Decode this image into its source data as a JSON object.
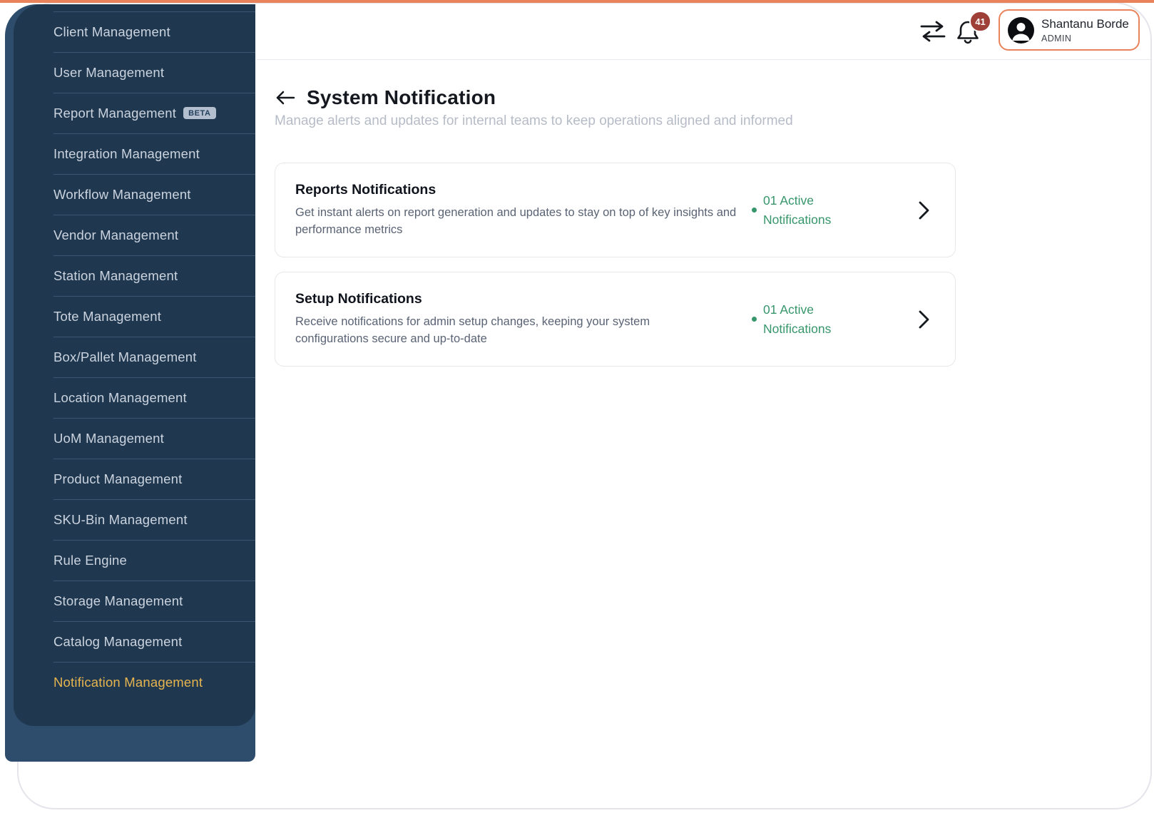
{
  "colors": {
    "accent": "#E8835C",
    "badge_red": "#9E4038",
    "sidebar_outer": "#2E4C6B",
    "sidebar_inner": "#1F3850",
    "sidebar_active": "#E6B44E",
    "status_green": "#37966B"
  },
  "sidebar": {
    "items": [
      {
        "label": "Client Management"
      },
      {
        "label": "User Management"
      },
      {
        "label": "Report Management",
        "badge": "BETA"
      },
      {
        "label": "Integration Management"
      },
      {
        "label": "Workflow Management"
      },
      {
        "label": "Vendor Management"
      },
      {
        "label": "Station Management"
      },
      {
        "label": "Tote Management"
      },
      {
        "label": "Box/Pallet Management"
      },
      {
        "label": "Location Management"
      },
      {
        "label": "UoM Management"
      },
      {
        "label": "Product Management"
      },
      {
        "label": "SKU-Bin Management"
      },
      {
        "label": "Rule Engine"
      },
      {
        "label": "Storage Management"
      },
      {
        "label": "Catalog Management"
      },
      {
        "label": "Notification Management",
        "active": true
      }
    ]
  },
  "header": {
    "notification_count": "41",
    "user": {
      "name": "Shantanu Borde",
      "role": "ADMIN"
    }
  },
  "page": {
    "title": "System Notification",
    "subtitle": "Manage alerts and updates for internal teams to keep operations aligned and informed"
  },
  "cards": [
    {
      "title": "Reports Notifications",
      "description": "Get instant alerts on report generation and updates to stay on top of key insights and performance metrics",
      "status": "01 Active Notifications"
    },
    {
      "title": "Setup Notifications",
      "description": "Receive notifications for admin setup changes, keeping your system configurations secure and up-to-date",
      "status": "01 Active Notifications"
    }
  ]
}
